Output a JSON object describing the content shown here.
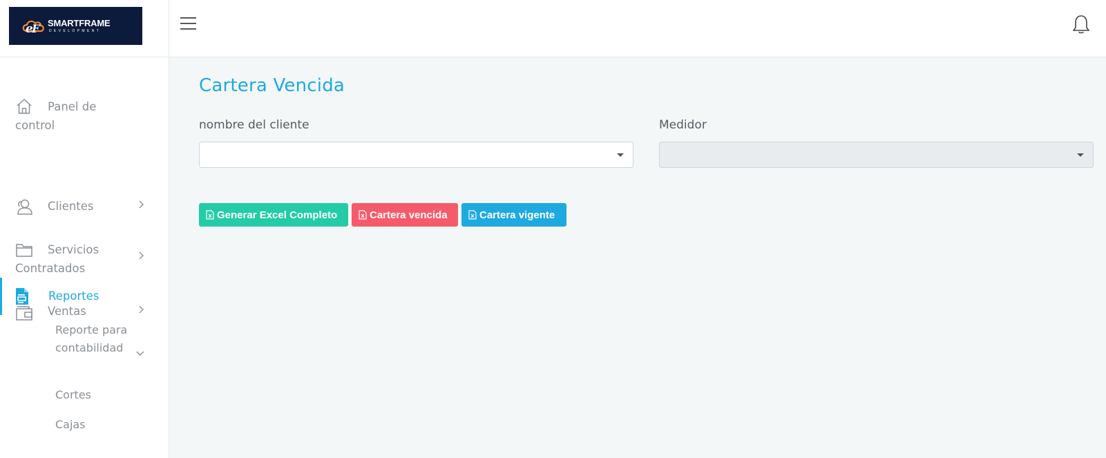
{
  "brand": {
    "logo_title": "SMARTFRAME",
    "logo_subtitle": "DEVELOPMENT"
  },
  "sidebar": {
    "items": [
      {
        "label_line1": "Panel de",
        "label_line2": "control",
        "icon": "home-icon"
      },
      {
        "label": "Clientes",
        "icon": "users-icon"
      },
      {
        "label_line1": "Servicios",
        "label_line2": "Contratados",
        "icon": "folder-icon"
      },
      {
        "label": "Ventas",
        "icon": "wallet-icon"
      },
      {
        "label": "Reportes",
        "icon": "document-icon",
        "active": true
      }
    ],
    "subitems": [
      {
        "label": "Reporte para contabilidad"
      },
      {
        "label": "Cortes"
      },
      {
        "label": "Cajas"
      }
    ]
  },
  "topbar": {
    "menu_icon": "hamburger-icon",
    "notification_icon": "bell-icon"
  },
  "main": {
    "title": "Cartera Vencida",
    "fields": {
      "client": {
        "label": "nombre del cliente",
        "value": ""
      },
      "meter": {
        "label": "Medidor",
        "value": ""
      }
    },
    "buttons": {
      "excel_full": "Generar Excel Completo",
      "overdue": "Cartera vencida",
      "current": "Cartera vigente"
    }
  },
  "colors": {
    "accent": "#1ea9e1",
    "btn_excel": "#23cca6",
    "btn_overdue": "#f55b6b",
    "btn_current": "#1ea9e1",
    "logo_bg": "#0c1a3c"
  }
}
